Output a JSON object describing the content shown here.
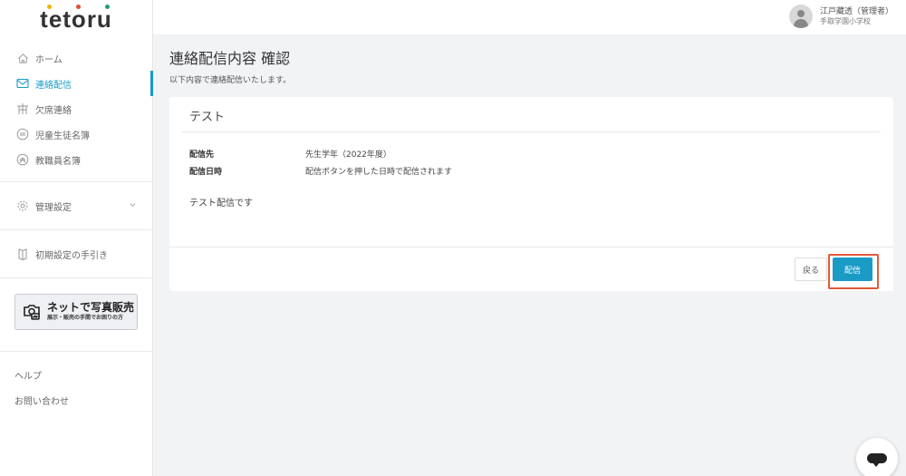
{
  "logo": {
    "text": "tetoru",
    "dot_colors": [
      "#f0b400",
      "#e44b3b",
      "#22a06b"
    ]
  },
  "header": {
    "user_name": "江戸藏透（管理者）",
    "school": "手取学園小学校"
  },
  "sidebar": {
    "items": [
      {
        "label": "ホーム",
        "icon": "home-icon"
      },
      {
        "label": "連絡配信",
        "icon": "mail-icon",
        "active": true
      },
      {
        "label": "欠席連絡",
        "icon": "absence-icon"
      },
      {
        "label": "児童生徒名簿",
        "icon": "student-list-icon"
      },
      {
        "label": "教職員名簿",
        "icon": "staff-list-icon"
      }
    ],
    "settings_label": "管理設定",
    "guide_label": "初期設定の手引き",
    "banner": {
      "title": "ネットで写真販売",
      "subtitle": "展示・販売の手間でお困りの方"
    },
    "help_label": "ヘルプ",
    "contact_label": "お問い合わせ"
  },
  "main": {
    "title": "連絡配信内容 確認",
    "subtitle": "以下内容で連絡配信いたします。",
    "card": {
      "title": "テスト",
      "rows": [
        {
          "label": "配信先",
          "value": "先生学年（2022年度）"
        },
        {
          "label": "配信日時",
          "value": "配信ボタンを押した日時で配信されます"
        }
      ],
      "body": "テスト配信です",
      "back_label": "戻る",
      "send_label": "配信"
    }
  },
  "colors": {
    "accent": "#1a9bc6",
    "highlight": "#e05a3e"
  }
}
